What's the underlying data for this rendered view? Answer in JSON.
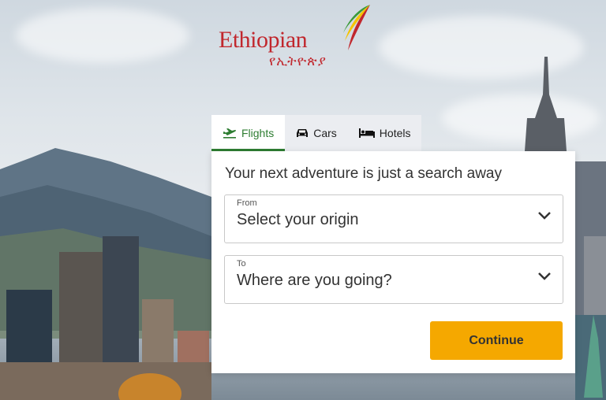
{
  "brand": {
    "name": "Ethiopian",
    "amharic": "የኢትዮጵያ",
    "colors": {
      "red": "#c1272d",
      "green": "#3a9a3a",
      "yellow": "#f5c400"
    }
  },
  "tabs": [
    {
      "label": "Flights",
      "icon": "plane-icon",
      "active": true
    },
    {
      "label": "Cars",
      "icon": "car-icon",
      "active": false
    },
    {
      "label": "Hotels",
      "icon": "bed-icon",
      "active": false
    }
  ],
  "search": {
    "headline": "Your next adventure is just a search away",
    "from": {
      "label": "From",
      "placeholder": "Select your origin"
    },
    "to": {
      "label": "To",
      "placeholder": "Where are you going?"
    },
    "submit_label": "Continue"
  },
  "colors": {
    "active_tab": "#2e7d32",
    "button": "#f5a800"
  }
}
